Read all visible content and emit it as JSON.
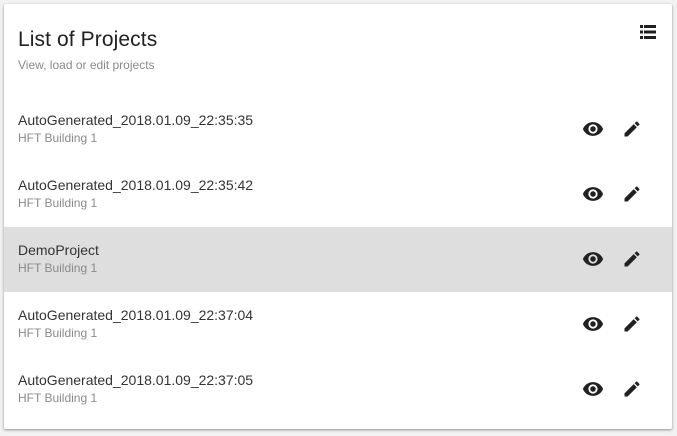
{
  "header": {
    "title": "List of Projects",
    "subtitle": "View, load or edit projects",
    "menu_icon": "list-view-icon"
  },
  "projects": [
    {
      "name": "AutoGenerated_2018.01.09_22:35:35",
      "building": "HFT Building 1",
      "selected": false
    },
    {
      "name": "AutoGenerated_2018.01.09_22:35:42",
      "building": "HFT Building 1",
      "selected": false
    },
    {
      "name": "DemoProject",
      "building": "HFT Building 1",
      "selected": true
    },
    {
      "name": "AutoGenerated_2018.01.09_22:37:04",
      "building": "HFT Building 1",
      "selected": false
    },
    {
      "name": "AutoGenerated_2018.01.09_22:37:05",
      "building": "HFT Building 1",
      "selected": false
    }
  ],
  "actions": {
    "view_icon": "eye-icon",
    "edit_icon": "pencil-icon"
  },
  "colors": {
    "selected_row": "#dedede",
    "icon": "#212121",
    "subtitle": "#8a8a8a"
  }
}
